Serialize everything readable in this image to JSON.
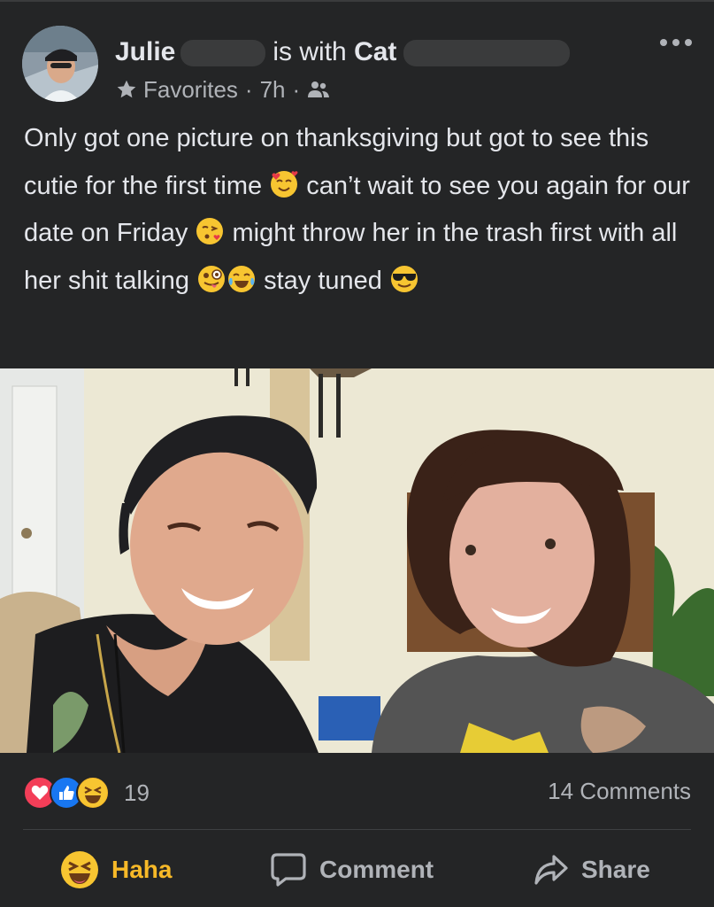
{
  "post": {
    "author_first": "Julie",
    "with_text": "is with",
    "tagged_first": "Cat",
    "audience": "Favorites",
    "time": "7h",
    "dot": "·",
    "caption_parts": [
      "Only got one picture on thanksgiving but got to see this cutie for the first time",
      "can’t wait to see you again for our date on Friday",
      "might throw her in the trash first with all her shit talking",
      "stay tuned"
    ]
  },
  "stats": {
    "reaction_count": "19",
    "comments_label": "14 Comments",
    "reaction_icons": [
      "love-reaction",
      "like-reaction",
      "haha-reaction"
    ]
  },
  "actions": {
    "haha_label": "Haha",
    "comment_label": "Comment",
    "share_label": "Share"
  },
  "colors": {
    "background": "#242526",
    "text": "#e4e6eb",
    "secondary_text": "#b0b3b8",
    "haha_yellow": "#f7b928",
    "like_blue": "#1877f2",
    "love_red": "#f33e58"
  }
}
